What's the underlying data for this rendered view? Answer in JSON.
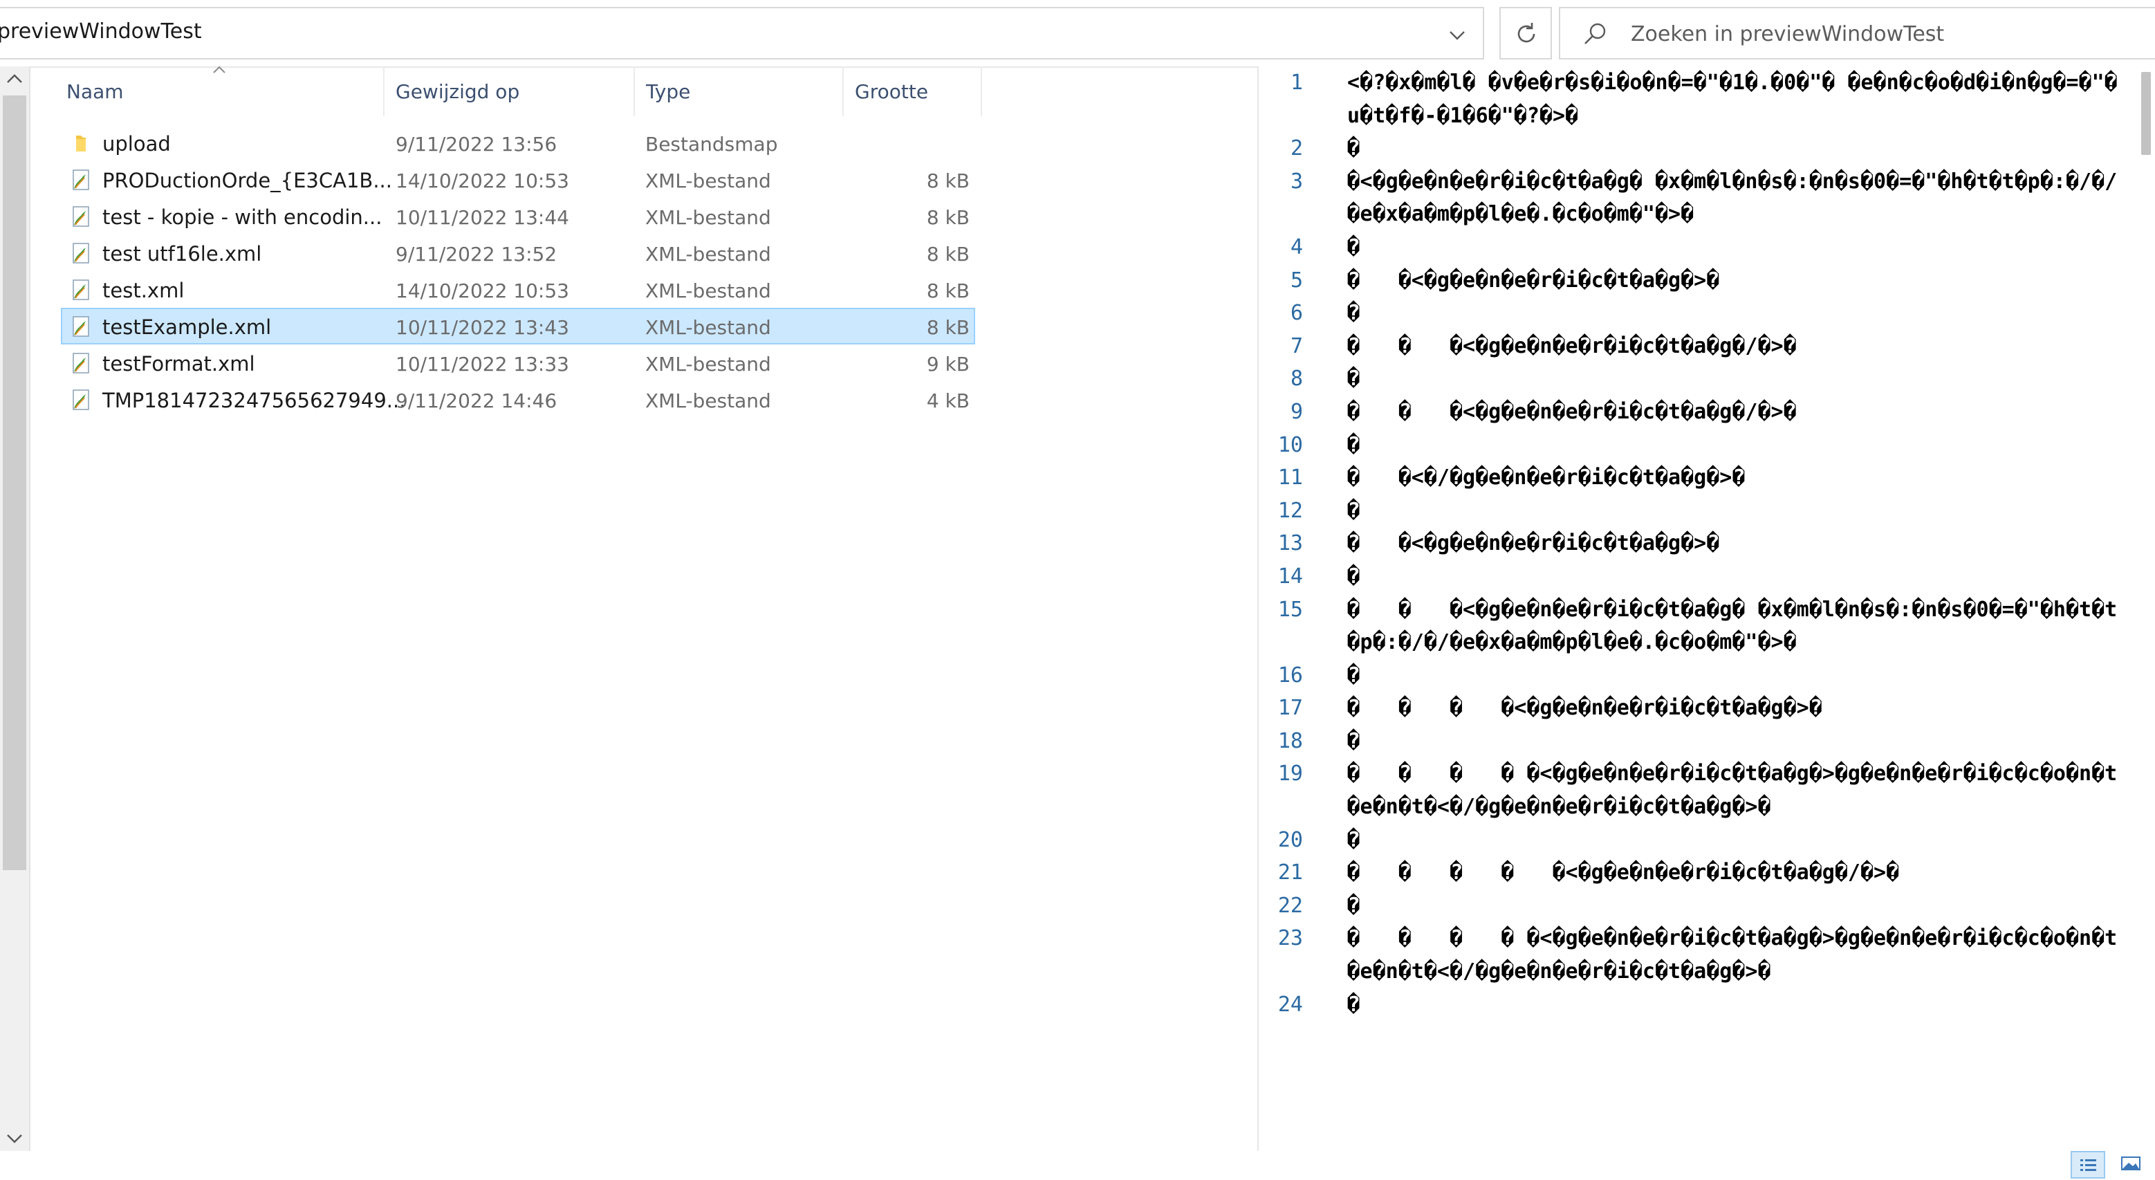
{
  "address_bar": {
    "path": "previewWindowTest"
  },
  "search": {
    "placeholder": "Zoeken in previewWindowTest"
  },
  "columns": {
    "name": "Naam",
    "modified": "Gewijzigd op",
    "type": "Type",
    "size": "Grootte"
  },
  "files": [
    {
      "name": "upload",
      "modified": "9/11/2022 13:56",
      "type": "Bestandsmap",
      "size": "",
      "icon": "folder-icon",
      "selected": false
    },
    {
      "name": "PRODuctionOrde_{E3CA1B...",
      "modified": "14/10/2022 10:53",
      "type": "XML-bestand",
      "size": "8 kB",
      "icon": "xml-file-icon",
      "selected": false
    },
    {
      "name": "test - kopie - with encodin...",
      "modified": "10/11/2022 13:44",
      "type": "XML-bestand",
      "size": "8 kB",
      "icon": "xml-file-icon",
      "selected": false
    },
    {
      "name": "test utf16le.xml",
      "modified": "9/11/2022 13:52",
      "type": "XML-bestand",
      "size": "8 kB",
      "icon": "xml-file-icon",
      "selected": false
    },
    {
      "name": "test.xml",
      "modified": "14/10/2022 10:53",
      "type": "XML-bestand",
      "size": "8 kB",
      "icon": "xml-file-icon",
      "selected": false
    },
    {
      "name": "testExample.xml",
      "modified": "10/11/2022 13:43",
      "type": "XML-bestand",
      "size": "8 kB",
      "icon": "xml-file-icon",
      "selected": true
    },
    {
      "name": "testFormat.xml",
      "modified": "10/11/2022 13:33",
      "type": "XML-bestand",
      "size": "9 kB",
      "icon": "xml-file-icon",
      "selected": false
    },
    {
      "name": "TMP1814723247565627949...",
      "modified": "9/11/2022 14:46",
      "type": "XML-bestand",
      "size": "4 kB",
      "icon": "xml-file-icon",
      "selected": false
    }
  ],
  "preview": {
    "lines": [
      {
        "n": "1",
        "text": "<�?�x�m�l� �v�e�r�s�i�o�n�=�\"�1�.�0�\"� �e�n�c�o�d�i�n�g�=�\"�u�t�f�-�1�6�\"�?�>�"
      },
      {
        "n": "2",
        "text": "�"
      },
      {
        "n": "3",
        "text": "�<�g�e�n�e�r�i�c�t�a�g� �x�m�l�n�s�:�n�s�0�=�\"�h�t�t�p�:�/�/�e�x�a�m�p�l�e�.�c�o�m�\"�>�"
      },
      {
        "n": "4",
        "text": "�"
      },
      {
        "n": "5",
        "text": "�   �<�g�e�n�e�r�i�c�t�a�g�>�"
      },
      {
        "n": "6",
        "text": "�"
      },
      {
        "n": "7",
        "text": "�   �   �<�g�e�n�e�r�i�c�t�a�g�/�>�"
      },
      {
        "n": "8",
        "text": "�"
      },
      {
        "n": "9",
        "text": "�   �   �<�g�e�n�e�r�i�c�t�a�g�/�>�"
      },
      {
        "n": "10",
        "text": "�"
      },
      {
        "n": "11",
        "text": "�   �<�/�g�e�n�e�r�i�c�t�a�g�>�"
      },
      {
        "n": "12",
        "text": "�"
      },
      {
        "n": "13",
        "text": "�   �<�g�e�n�e�r�i�c�t�a�g�>�"
      },
      {
        "n": "14",
        "text": "�"
      },
      {
        "n": "15",
        "text": "�   �   �<�g�e�n�e�r�i�c�t�a�g� �x�m�l�n�s�:�n�s�0�=�\"�h�t�t�p�:�/�/�e�x�a�m�p�l�e�.�c�o�m�\"�>�"
      },
      {
        "n": "16",
        "text": "�"
      },
      {
        "n": "17",
        "text": "�   �   �   �<�g�e�n�e�r�i�c�t�a�g�>�"
      },
      {
        "n": "18",
        "text": "�"
      },
      {
        "n": "19",
        "text": "�   �   �   � �<�g�e�n�e�r�i�c�t�a�g�>�g�e�n�e�r�i�c�c�o�n�t�e�n�t�<�/�g�e�n�e�r�i�c�t�a�g�>�"
      },
      {
        "n": "20",
        "text": "�"
      },
      {
        "n": "21",
        "text": "�   �   �   �   �<�g�e�n�e�r�i�c�t�a�g�/�>�"
      },
      {
        "n": "22",
        "text": "�"
      },
      {
        "n": "23",
        "text": "�   �   �   � �<�g�e�n�e�r�i�c�t�a�g�>�g�e�n�e�r�i�c�c�o�n�t�e�n�t�<�/�g�e�n�e�r�i�c�t�a�g�>�"
      },
      {
        "n": "24",
        "text": "�"
      }
    ]
  },
  "colors": {
    "selection_bg": "#cce8ff",
    "selection_border": "#99d1ff",
    "line_number": "#2b6aa3",
    "header_text": "#3c5070"
  },
  "icons": {
    "dropdown": "chevron-down-icon",
    "refresh": "refresh-icon",
    "search": "search-icon",
    "details_view": "details-view-icon",
    "tiles_view": "large-icons-view-icon"
  }
}
